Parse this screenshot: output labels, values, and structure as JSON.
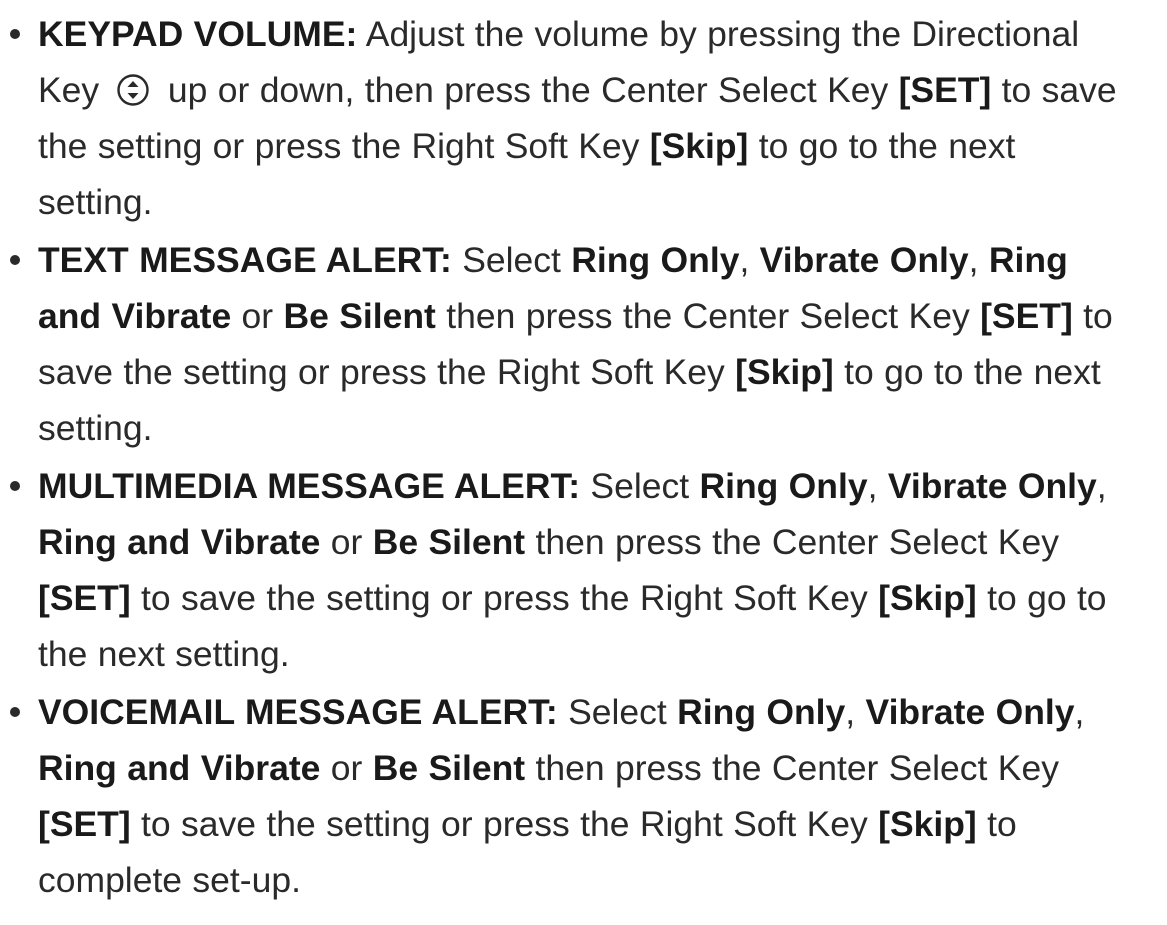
{
  "items": [
    {
      "runs": [
        {
          "text": "KEYPAD VOLUME:",
          "bold": true
        },
        {
          "text": " Adjust the volume by pressing the Directional Key "
        },
        {
          "icon": "directional-key-icon"
        },
        {
          "text": " up or down, then press the Center Select Key "
        },
        {
          "text": "[SET]",
          "bold": true
        },
        {
          "text": " to save the setting or press the Right Soft Key "
        },
        {
          "text": "[Skip]",
          "bold": true
        },
        {
          "text": " to go to the next setting."
        }
      ]
    },
    {
      "runs": [
        {
          "text": "TEXT MESSAGE ALERT:",
          "bold": true
        },
        {
          "text": " Select "
        },
        {
          "text": "Ring Only",
          "bold": true
        },
        {
          "text": ", "
        },
        {
          "text": "Vibrate Only",
          "bold": true
        },
        {
          "text": ", "
        },
        {
          "text": "Ring and Vibrate",
          "bold": true
        },
        {
          "text": " or "
        },
        {
          "text": "Be Silent",
          "bold": true
        },
        {
          "text": " then press the Center Select Key "
        },
        {
          "text": "[SET]",
          "bold": true
        },
        {
          "text": " to save the setting or press the Right Soft Key "
        },
        {
          "text": "[Skip]",
          "bold": true
        },
        {
          "text": " to go to the next setting."
        }
      ]
    },
    {
      "runs": [
        {
          "text": "MULTIMEDIA MESSAGE ALERT:",
          "bold": true
        },
        {
          "text": " Select "
        },
        {
          "text": "Ring Only",
          "bold": true
        },
        {
          "text": ", "
        },
        {
          "text": "Vibrate Only",
          "bold": true
        },
        {
          "text": ", "
        },
        {
          "text": "Ring and Vibrate",
          "bold": true
        },
        {
          "text": " or "
        },
        {
          "text": "Be Silent",
          "bold": true
        },
        {
          "text": " then press the Center Select Key "
        },
        {
          "text": "[SET]",
          "bold": true
        },
        {
          "text": " to save the setting or press the Right Soft Key "
        },
        {
          "text": "[Skip]",
          "bold": true
        },
        {
          "text": " to go to the next setting."
        }
      ]
    },
    {
      "runs": [
        {
          "text": "VOICEMAIL MESSAGE ALERT:",
          "bold": true
        },
        {
          "text": " Select "
        },
        {
          "text": "Ring Only",
          "bold": true
        },
        {
          "text": ", "
        },
        {
          "text": "Vibrate Only",
          "bold": true
        },
        {
          "text": ", "
        },
        {
          "text": "Ring and Vibrate",
          "bold": true
        },
        {
          "text": " or "
        },
        {
          "text": "Be Silent",
          "bold": true
        },
        {
          "text": " then press the Center Select Key "
        },
        {
          "text": "[SET]",
          "bold": true
        },
        {
          "text": " to save the setting or press the Right Soft Key "
        },
        {
          "text": "[Skip]",
          "bold": true
        },
        {
          "text": " to complete set-up."
        }
      ]
    }
  ],
  "colors": {
    "text": "#2a2a2a",
    "bold_text": "#1a1a1a",
    "background": "#ffffff"
  }
}
